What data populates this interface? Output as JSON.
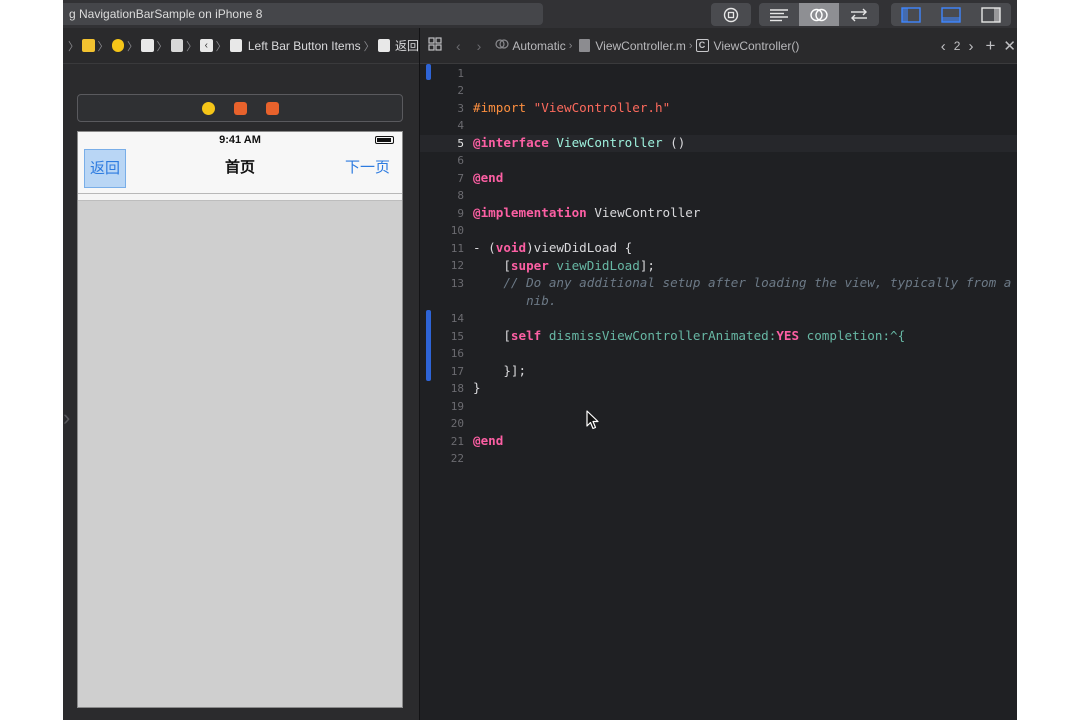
{
  "toolbar": {
    "scheme_text": "g NavigationBarSample on iPhone 8",
    "stop_icon": "stop-icon",
    "editor_modes": [
      "standard-editor-icon",
      "assistant-editor-icon",
      "version-editor-icon"
    ],
    "panels": [
      "navigator-panel-icon",
      "debug-panel-icon",
      "inspector-panel-icon"
    ]
  },
  "ib_jumpbar": {
    "item_last_group": "Left Bar Button Items",
    "item_last": "返回"
  },
  "device": {
    "time": "9:41 AM",
    "nav_back": "返回",
    "nav_title": "首页",
    "nav_next": "下一页"
  },
  "editor_jumpbar": {
    "mode": "Automatic",
    "file": "ViewController.m",
    "class_badge": "C",
    "symbol": "ViewController()",
    "count": "2"
  },
  "colors": {
    "keyword": "#fc5fa3",
    "preprocessor": "#fd8f3f",
    "string": "#fc6a5d",
    "class": "#9ef1dd",
    "comment": "#6c7986",
    "change_bar": "#2e64d6"
  },
  "code": {
    "line_numbers": [
      "1",
      "2",
      "3",
      "4",
      "5",
      "6",
      "7",
      "8",
      "9",
      "10",
      "11",
      "12",
      "13",
      "14",
      "15",
      "16",
      "17",
      "18",
      "19",
      "20",
      "21",
      "22"
    ],
    "current_line": "5",
    "l3_import": "#import",
    "l3_file": "\"ViewController.h\"",
    "l5_kw": "@interface",
    "l5_cls": "ViewController",
    "l5_rest": " ()",
    "l7_kw": "@end",
    "l9_kw": "@implementation",
    "l9_cls": " ViewController",
    "l11_a": "- (",
    "l11_void": "void",
    "l11_b": ")viewDidLoad {",
    "l12_a": "    [",
    "l12_super": "super",
    "l12_b": " viewDidLoad",
    "l12_c": "];",
    "l13_a": "    // Do any additional setup after loading the view, typically from a",
    "l13_b": "       nib.",
    "l15_a": "    [",
    "l15_self": "self",
    "l15_b": " dismissViewControllerAnimated:",
    "l15_yes": "YES",
    "l15_c": " completion:^{",
    "l17": "    }];",
    "l18": "}",
    "l21_kw": "@end"
  }
}
